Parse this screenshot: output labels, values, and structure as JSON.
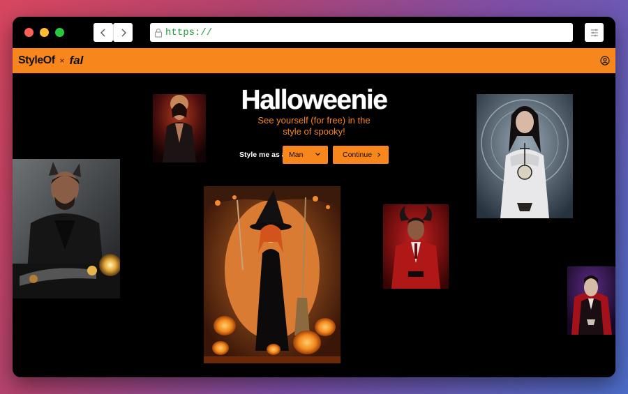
{
  "browser": {
    "url": "https://",
    "icons": {
      "back": "chevron-left-icon",
      "forward": "chevron-right-icon",
      "lock": "lock-icon",
      "menu": "sliders-icon"
    }
  },
  "header": {
    "brand": "StyleOf",
    "separator": "×",
    "partner": "fal",
    "account_icon": "user-circle-icon"
  },
  "hero": {
    "title": "Halloweenie",
    "subtitle_line1": "See yourself (for free) in the",
    "subtitle_line2": "style of spooky!",
    "style_label": "Style me as a",
    "select_value": "Man",
    "continue_label": "Continue",
    "continue_icon": "arrow-right-icon"
  },
  "colors": {
    "accent": "#f7871d",
    "background": "#000000",
    "url_text": "#1f9d3a"
  }
}
